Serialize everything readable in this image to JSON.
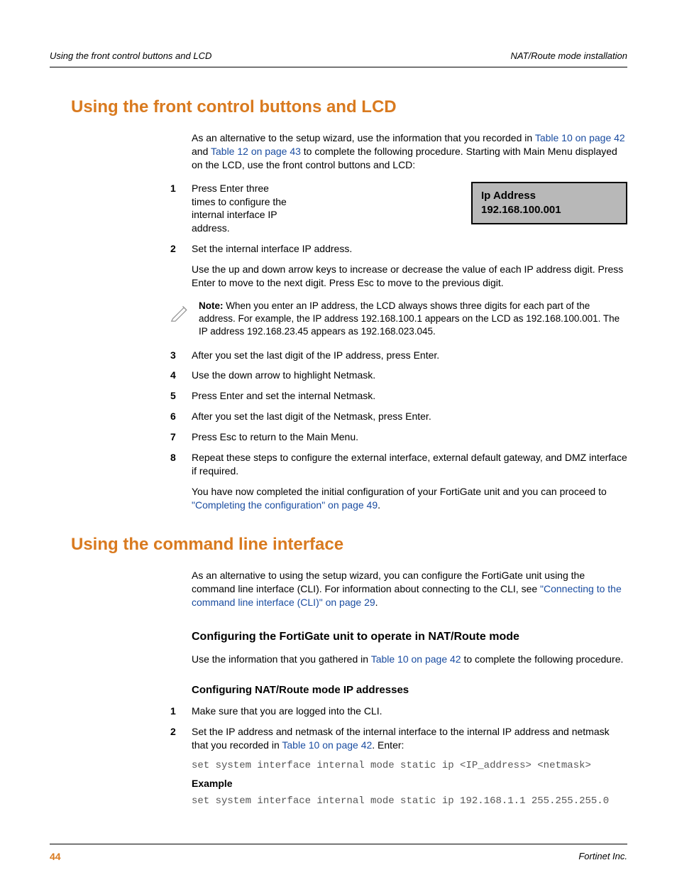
{
  "header": {
    "left": "Using the front control buttons and LCD",
    "right": "NAT/Route mode installation"
  },
  "section1": {
    "title": "Using the front control buttons and LCD",
    "intro_1": "As an alternative to the setup wizard, use the information that you recorded in ",
    "link_t10": "Table 10 on page 42",
    "intro_2": " and ",
    "link_t12": "Table 12 on page 43",
    "intro_3": " to complete the following procedure. Starting with Main Menu displayed on the LCD, use the front control buttons and LCD:",
    "lcd_line1": "Ip Address",
    "lcd_line2": "192.168.100.001",
    "steps": {
      "s1_num": "1",
      "s1": "Press Enter three times to configure the internal interface IP address.",
      "s2_num": "2",
      "s2": "Set the internal interface IP address.",
      "s2b": "Use the up and down arrow keys to increase or decrease the value of each IP address digit. Press Enter to move to the next digit. Press Esc to move to the previous digit.",
      "note_label": "Note:",
      "note": " When you enter an IP address, the LCD always shows three digits for each part of the address. For example, the IP address 192.168.100.1 appears on the LCD as 192.168.100.001. The IP address 192.168.23.45 appears as 192.168.023.045.",
      "s3_num": "3",
      "s3": "After you set the last digit of the IP address, press Enter.",
      "s4_num": "4",
      "s4": "Use the down arrow to highlight Netmask.",
      "s5_num": "5",
      "s5": "Press Enter and set the internal Netmask.",
      "s6_num": "6",
      "s6": "After you set the last digit of the Netmask, press Enter.",
      "s7_num": "7",
      "s7": "Press Esc to return to the Main Menu.",
      "s8_num": "8",
      "s8": "Repeat these steps to configure the external interface, external default gateway, and DMZ interface if required.",
      "closing_1": "You have now completed the initial configuration of your FortiGate unit and you can proceed to ",
      "closing_link": "\"Completing the configuration\" on page 49",
      "closing_2": "."
    }
  },
  "section2": {
    "title": "Using the command line interface",
    "intro_1": "As an alternative to using the setup wizard, you can configure the FortiGate unit using the command line interface (CLI). For information about connecting to the CLI, see ",
    "intro_link": "\"Connecting to the command line interface (CLI)\" on page 29",
    "intro_2": ".",
    "sub1_title": "Configuring the FortiGate unit to operate in NAT/Route mode",
    "sub1_text_1": "Use the information that you gathered in ",
    "sub1_link": "Table 10 on page 42",
    "sub1_text_2": " to complete the following procedure.",
    "sub2_title": "Configuring NAT/Route mode IP addresses",
    "steps": {
      "s1_num": "1",
      "s1": "Make sure that you are logged into the CLI.",
      "s2_num": "2",
      "s2_1": "Set the IP address and netmask of the internal interface to the internal IP address and netmask that you recorded in ",
      "s2_link": "Table 10 on page 42",
      "s2_2": ". Enter:",
      "code1": "set system interface internal mode static ip <IP_address> <netmask>",
      "example_label": "Example",
      "code2": "set system interface internal mode static ip 192.168.1.1 255.255.255.0"
    }
  },
  "footer": {
    "page": "44",
    "right": "Fortinet Inc."
  }
}
